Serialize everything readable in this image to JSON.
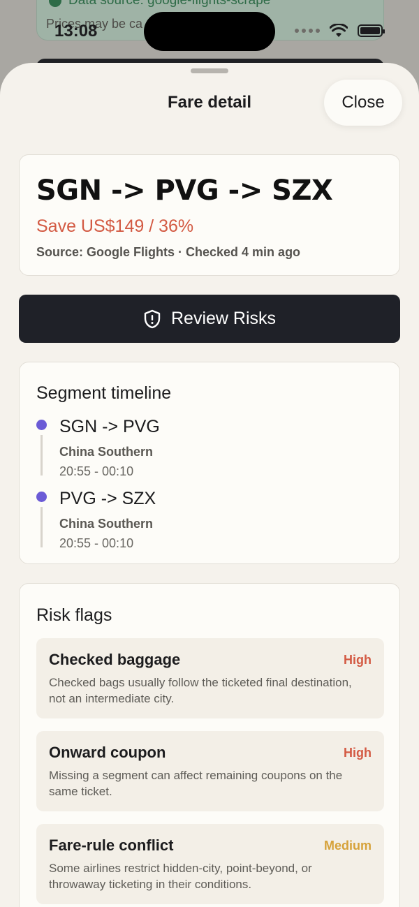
{
  "background": {
    "source_text": "Data source: google-flights-scrape",
    "prices_text": "Prices may be ca"
  },
  "status_bar": {
    "time": "13:08"
  },
  "sheet": {
    "title": "Fare detail",
    "close_label": "Close"
  },
  "route": {
    "title": "SGN -> PVG -> SZX",
    "savings": "Save US$149 / 36%",
    "source": "Source: Google Flights · Checked 4 min ago"
  },
  "review_button": {
    "label": "Review Risks",
    "icon": "shield-alert-icon"
  },
  "timeline": {
    "title": "Segment timeline",
    "segments": [
      {
        "route": "SGN -> PVG",
        "airline": "China Southern",
        "time": "20:55 - 00:10"
      },
      {
        "route": "PVG -> SZX",
        "airline": "China Southern",
        "time": "20:55 - 00:10"
      }
    ]
  },
  "risks": {
    "title": "Risk flags",
    "items": [
      {
        "name": "Checked baggage",
        "level": "High",
        "color": "#d35a43",
        "description": "Checked bags usually follow the ticketed final destination, not an intermediate city."
      },
      {
        "name": "Onward coupon",
        "level": "High",
        "color": "#d35a43",
        "description": "Missing a segment can affect remaining coupons on the same ticket."
      },
      {
        "name": "Fare-rule conflict",
        "level": "Medium",
        "color": "#d6a23a",
        "description": "Some airlines restrict hidden-city, point-beyond, or throwaway ticketing in their conditions."
      }
    ]
  },
  "colors": {
    "accent_dark": "#1f2128",
    "savings": "#d35a43",
    "timeline_dot": "#6b5bd6",
    "high": "#d35a43",
    "medium": "#d6a23a"
  }
}
